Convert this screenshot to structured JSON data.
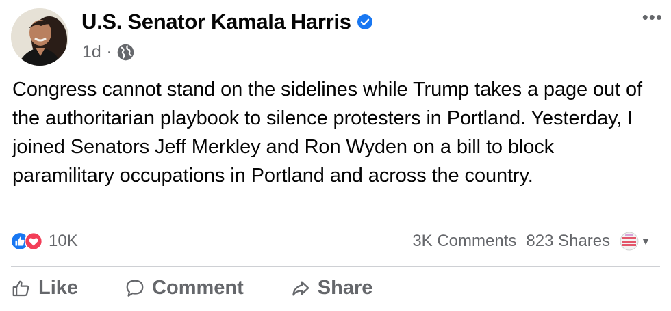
{
  "post": {
    "author": "U.S. Senator Kamala Harris",
    "timestamp": "1d",
    "separator": "·",
    "audience_icon": "globe-icon",
    "text": "Congress cannot stand on the sidelines while Trump takes a page out of the authoritarian playbook to silence protesters in Portland. Yesterday, I joined Senators Jeff Merkley and Ron Wyden on a bill to block paramilitary occupations in Portland and across the country."
  },
  "stats": {
    "reaction_count": "10K",
    "comments": "3K Comments",
    "shares": "823 Shares"
  },
  "actions": {
    "like": "Like",
    "comment": "Comment",
    "share": "Share"
  },
  "colors": {
    "verified_blue": "#1877f2",
    "like_blue": "#1877f2",
    "love_red": "#f33e58",
    "secondary_text": "#65676b",
    "divider": "#ced0d4"
  }
}
